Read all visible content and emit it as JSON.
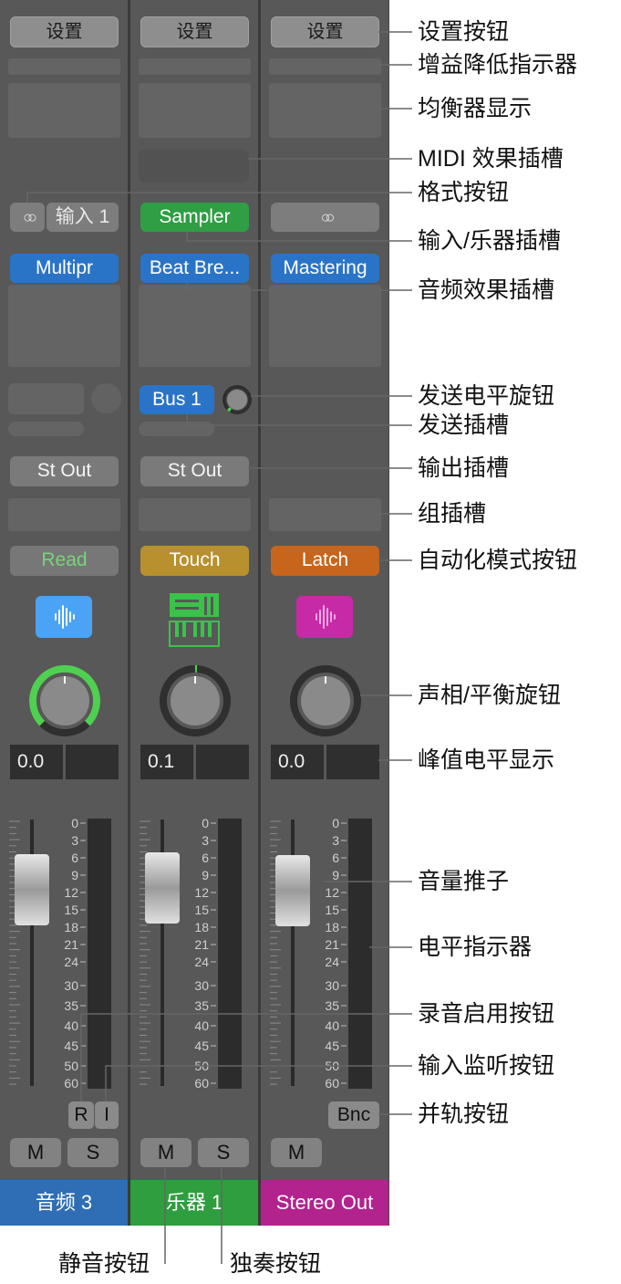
{
  "strips": [
    {
      "settings_label": "设置",
      "input_label": "输入 1",
      "format_icon": "stereo-link-icon",
      "audio_fx_label": "Multipr",
      "automation_label": "Read",
      "automation_color": "#7ad37a",
      "track_icon": "waveform-icon",
      "track_icon_color": "#4ba3f5",
      "pan_value": "0.0",
      "name": "音频 3",
      "name_color": "#2f6db5",
      "mute_label": "M",
      "solo_label": "S",
      "record_label": "R",
      "input_monitor_label": "I"
    },
    {
      "settings_label": "设置",
      "instrument_label": "Sampler",
      "audio_fx_label": "Beat Bre...",
      "send_label": "Bus 1",
      "output_label": "St Out",
      "automation_label": "Touch",
      "automation_color": "#b8902e",
      "track_icon": "keyboard-icon",
      "track_icon_color": "#3bc24a",
      "pan_value": "0.1",
      "name": "乐器 1",
      "name_color": "#2e9e3e",
      "mute_label": "M",
      "solo_label": "S"
    },
    {
      "settings_label": "设置",
      "format_icon": "stereo-link-icon",
      "audio_fx_label": "Mastering",
      "automation_label": "Latch",
      "automation_color": "#c7651c",
      "track_icon": "waveform-icon",
      "track_icon_color": "#c72aa6",
      "pan_value": "0.0",
      "name": "Stereo Out",
      "name_color": "#b2238e",
      "mute_label": "M",
      "bounce_label": "Bnc"
    }
  ],
  "strip1_output_label": "St Out",
  "meter_scale": [
    "0",
    "3",
    "6",
    "9",
    "12",
    "15",
    "18",
    "21",
    "24",
    "30",
    "35",
    "40",
    "45",
    "50",
    "60"
  ],
  "callouts": {
    "settings": "设置按钮",
    "gain_reduction": "增益降低指示器",
    "eq": "均衡器显示",
    "midi_fx": "MIDI 效果插槽",
    "format": "格式按钮",
    "input_instrument": "输入/乐器插槽",
    "audio_fx": "音频效果插槽",
    "send_level": "发送电平旋钮",
    "send_slot": "发送插槽",
    "output": "输出插槽",
    "group": "组插槽",
    "automation": "自动化模式按钮",
    "pan": "声相/平衡旋钮",
    "peak": "峰值电平显示",
    "fader": "音量推子",
    "level_meter": "电平指示器",
    "record": "录音启用按钮",
    "input_monitor": "输入监听按钮",
    "bounce": "并轨按钮",
    "mute": "静音按钮",
    "solo": "独奏按钮"
  }
}
